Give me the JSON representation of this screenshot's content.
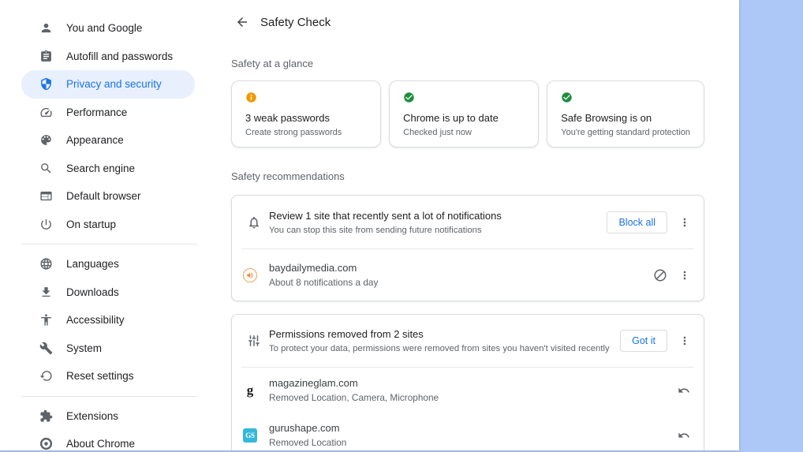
{
  "colors": {
    "accent_blue": "#1a73e8",
    "selected_pill_bg": "#e8f0fe",
    "warning_orange": "#f29900",
    "ok_green": "#1e8e3e",
    "text_primary": "#202124",
    "text_secondary": "#5f6368",
    "card_border": "#dadce0",
    "desktop_background_blue": "#adc8f6",
    "gurushape_favicon_teal": "#35b8d9",
    "baydailymedia_favicon_orange": "#ef8733"
  },
  "sidebar": {
    "groups": [
      {
        "items": [
          {
            "label": "You and Google",
            "icon": "person-icon"
          },
          {
            "label": "Autofill and passwords",
            "icon": "clipboard-icon"
          },
          {
            "label": "Privacy and security",
            "icon": "shield-icon",
            "selected": true
          },
          {
            "label": "Performance",
            "icon": "speedometer-icon"
          },
          {
            "label": "Appearance",
            "icon": "palette-icon"
          },
          {
            "label": "Search engine",
            "icon": "search-icon"
          },
          {
            "label": "Default browser",
            "icon": "browser-window-icon"
          },
          {
            "label": "On startup",
            "icon": "power-icon"
          }
        ]
      },
      {
        "items": [
          {
            "label": "Languages",
            "icon": "globe-icon"
          },
          {
            "label": "Downloads",
            "icon": "download-icon"
          },
          {
            "label": "Accessibility",
            "icon": "accessibility-icon"
          },
          {
            "label": "System",
            "icon": "wrench-icon"
          },
          {
            "label": "Reset settings",
            "icon": "reset-icon"
          }
        ]
      },
      {
        "items": [
          {
            "label": "Extensions",
            "icon": "puzzle-icon"
          },
          {
            "label": "About Chrome",
            "icon": "chrome-logo-icon"
          }
        ]
      }
    ]
  },
  "header": {
    "title": "Safety Check"
  },
  "glance": {
    "section_label": "Safety at a glance",
    "cards": [
      {
        "status": "warning",
        "icon": "info-icon",
        "title": "3 weak passwords",
        "subtitle": "Create strong passwords"
      },
      {
        "status": "ok",
        "icon": "check-circle-icon",
        "title": "Chrome is up to date",
        "subtitle": "Checked just now"
      },
      {
        "status": "ok",
        "icon": "check-circle-icon",
        "title": "Safe Browsing is on",
        "subtitle": "You're getting standard protection"
      }
    ]
  },
  "recommendations": {
    "section_label": "Safety recommendations",
    "cards": [
      {
        "icon": "bell-icon",
        "title": "Review 1 site that recently sent a lot of notifications",
        "subtitle": "You can stop this site from sending future notifications",
        "action_label": "Block all",
        "sites": [
          {
            "favicon": "speaker-icon",
            "name": "baydailymedia.com",
            "detail": "About 8 notifications a day",
            "actions": [
              "block",
              "menu"
            ]
          }
        ]
      },
      {
        "icon": "tune-icon",
        "title": "Permissions removed from 2 sites",
        "subtitle": "To protect your data, permissions were removed from sites you haven't visited recently",
        "action_label": "Got it",
        "sites": [
          {
            "favicon_text": "g",
            "name": "magazineglam.com",
            "detail": "Removed Location, Camera, Microphone",
            "actions": [
              "undo"
            ]
          },
          {
            "favicon_text": "GS",
            "name": "gurushape.com",
            "detail": "Removed Location",
            "actions": [
              "undo"
            ]
          }
        ]
      }
    ]
  }
}
